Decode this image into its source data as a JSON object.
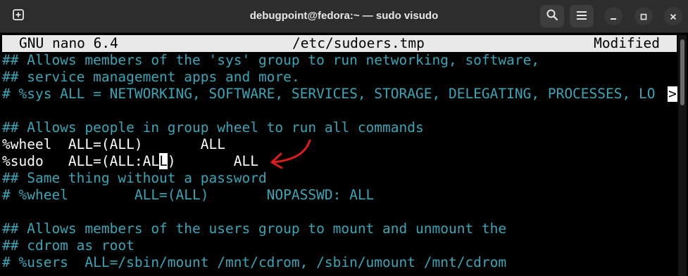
{
  "window": {
    "title": "debugpoint@fedora:~ — sudo visudo",
    "icons": {
      "new_tab": "plus-square-icon",
      "search": "search-icon",
      "menu": "hamburger-menu-icon",
      "minimize": "minimize-icon",
      "maximize": "maximize-icon",
      "close": "close-icon"
    }
  },
  "nano": {
    "statusbar": {
      "version": "GNU nano 6.4",
      "filename": "/etc/sudoers.tmp",
      "state": "Modified"
    },
    "lines": [
      {
        "text": "## Allows members of the 'sys' group to run networking, software,",
        "type": "comment"
      },
      {
        "text": "## service management apps and more.",
        "type": "comment"
      },
      {
        "text": "# %sys ALL = NETWORKING, SOFTWARE, SERVICES, STORAGE, DELEGATING, PROCESSES, LO",
        "type": "comment",
        "overflow_marker": ">"
      },
      {
        "text": "",
        "type": "blank"
      },
      {
        "text": "## Allows people in group wheel to run all commands",
        "type": "comment"
      },
      {
        "text": "%wheel  ALL=(ALL)       ALL",
        "type": "code"
      },
      {
        "text_before_cursor": "%sudo   ALL=(ALL:AL",
        "cursor_char": "L",
        "text_after_cursor": ")       ALL",
        "type": "code"
      },
      {
        "text": "## Same thing without a password",
        "type": "comment"
      },
      {
        "text": "# %wheel        ALL=(ALL)       NOPASSWD: ALL",
        "type": "comment"
      },
      {
        "text": "",
        "type": "blank"
      },
      {
        "text": "## Allows members of the users group to mount and unmount the",
        "type": "comment"
      },
      {
        "text": "## cdrom as root",
        "type": "comment"
      },
      {
        "text": "# %users  ALL=/sbin/mount /mnt/cdrom, /sbin/umount /mnt/cdrom",
        "type": "comment"
      }
    ]
  },
  "colors": {
    "comment": "#3aa5b5",
    "code": "#ffffff",
    "background": "#000000",
    "annotation_arrow": "#e01b1b"
  }
}
